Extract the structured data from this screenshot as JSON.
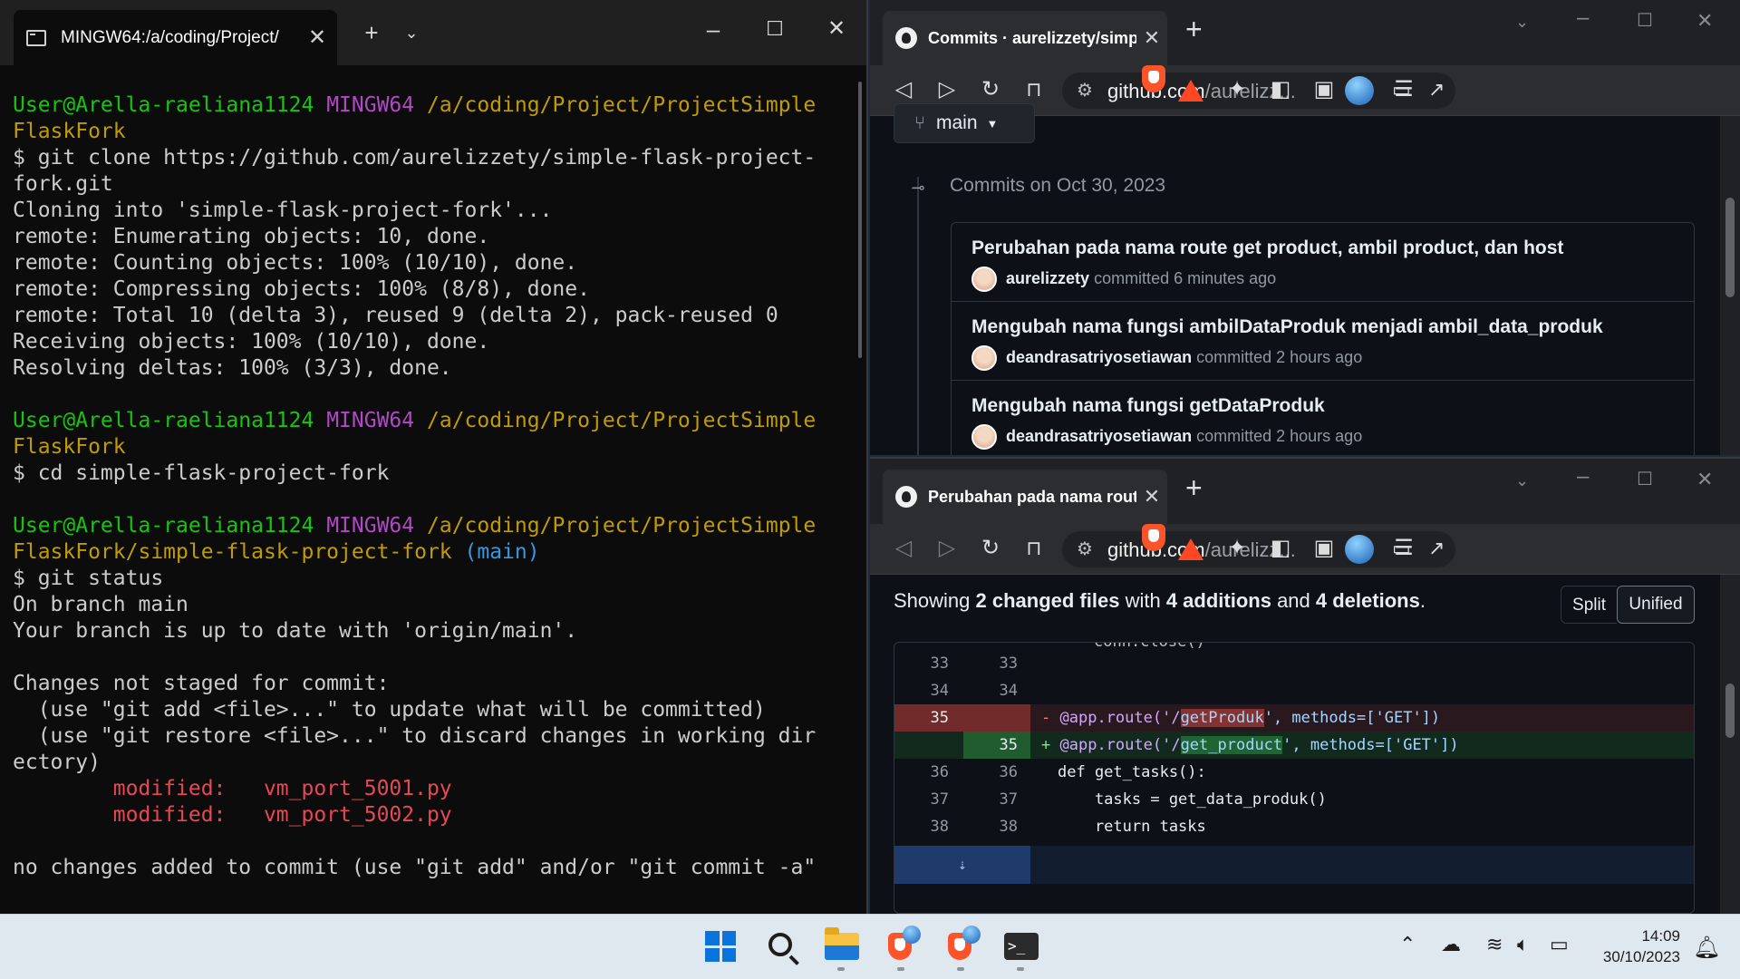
{
  "terminal": {
    "tab_title": "MINGW64:/a/coding/Project/",
    "lines": [
      [
        {
          "t": "User@Arella-raeliana1124 ",
          "c": "green"
        },
        {
          "t": "MINGW64 ",
          "c": "purple"
        },
        {
          "t": "/a/coding/Project/ProjectSimple",
          "c": "yellow"
        }
      ],
      [
        {
          "t": "FlaskFork",
          "c": "yellow"
        }
      ],
      [
        {
          "t": "$ git clone https://github.com/aurelizzety/simple-flask-project-",
          "c": "white"
        }
      ],
      [
        {
          "t": "fork.git",
          "c": "white"
        }
      ],
      [
        {
          "t": "Cloning into 'simple-flask-project-fork'...",
          "c": "white"
        }
      ],
      [
        {
          "t": "remote: Enumerating objects: 10, done.",
          "c": "white"
        }
      ],
      [
        {
          "t": "remote: Counting objects: 100% (10/10), done.",
          "c": "white"
        }
      ],
      [
        {
          "t": "remote: Compressing objects: 100% (8/8), done.",
          "c": "white"
        }
      ],
      [
        {
          "t": "remote: Total 10 (delta 3), reused 9 (delta 2), pack-reused 0",
          "c": "white"
        }
      ],
      [
        {
          "t": "Receiving objects: 100% (10/10), done.",
          "c": "white"
        }
      ],
      [
        {
          "t": "Resolving deltas: 100% (3/3), done.",
          "c": "white"
        }
      ],
      [
        {
          "t": "",
          "c": "white"
        }
      ],
      [
        {
          "t": "User@Arella-raeliana1124 ",
          "c": "green"
        },
        {
          "t": "MINGW64 ",
          "c": "purple"
        },
        {
          "t": "/a/coding/Project/ProjectSimple",
          "c": "yellow"
        }
      ],
      [
        {
          "t": "FlaskFork",
          "c": "yellow"
        }
      ],
      [
        {
          "t": "$ cd simple-flask-project-fork",
          "c": "white"
        }
      ],
      [
        {
          "t": "",
          "c": "white"
        }
      ],
      [
        {
          "t": "User@Arella-raeliana1124 ",
          "c": "green"
        },
        {
          "t": "MINGW64 ",
          "c": "purple"
        },
        {
          "t": "/a/coding/Project/ProjectSimple",
          "c": "yellow"
        }
      ],
      [
        {
          "t": "FlaskFork/simple-flask-project-fork ",
          "c": "yellow"
        },
        {
          "t": "(main)",
          "c": "cyan"
        }
      ],
      [
        {
          "t": "$ git status",
          "c": "white"
        }
      ],
      [
        {
          "t": "On branch main",
          "c": "white"
        }
      ],
      [
        {
          "t": "Your branch is up to date with 'origin/main'.",
          "c": "white"
        }
      ],
      [
        {
          "t": "",
          "c": "white"
        }
      ],
      [
        {
          "t": "Changes not staged for commit:",
          "c": "white"
        }
      ],
      [
        {
          "t": "  (use \"git add <file>...\" to update what will be committed)",
          "c": "white"
        }
      ],
      [
        {
          "t": "  (use \"git restore <file>...\" to discard changes in working dir",
          "c": "white"
        }
      ],
      [
        {
          "t": "ectory)",
          "c": "white"
        }
      ],
      [
        {
          "t": "        modified:   vm_port_5001.py",
          "c": "red"
        }
      ],
      [
        {
          "t": "        modified:   vm_port_5002.py",
          "c": "red"
        }
      ],
      [
        {
          "t": "",
          "c": "white"
        }
      ],
      [
        {
          "t": "no changes added to commit (use \"git add\" and/or \"git commit -a\"",
          "c": "white"
        }
      ]
    ]
  },
  "browser_top": {
    "tab_title": "Commits · aurelizzety/simple-fla",
    "url_host": "github.com",
    "url_rest": "/aurelizz...",
    "branch": "main",
    "commits_date": "Commits on Oct 30, 2023",
    "commits": [
      {
        "message": "Perubahan pada nama route get product, ambil product, dan host",
        "author": "aurelizzety",
        "time": "committed 6 minutes ago"
      },
      {
        "message": "Mengubah nama fungsi ambilDataProduk menjadi ambil_data_produk",
        "author": "deandrasatriyosetiawan",
        "time": "committed 2 hours ago"
      },
      {
        "message": "Mengubah nama fungsi getDataProduk",
        "author": "deandrasatriyosetiawan",
        "time": "committed 2 hours ago"
      }
    ]
  },
  "browser_bottom": {
    "tab_title": "Perubahan pada nama route get",
    "url_host": "github.com",
    "url_rest": "/aurelizz...",
    "summary": {
      "prefix": "Showing ",
      "files": "2 changed files",
      "mid1": " with ",
      "additions": "4 additions",
      "mid2": " and ",
      "deletions": "4 deletions",
      "suffix": "."
    },
    "split_label": "Split",
    "unified_label": "Unified",
    "diff_rows": [
      {
        "type": "ctx",
        "l": "33",
        "r": "33",
        "code": ""
      },
      {
        "type": "ctx",
        "l": "34",
        "r": "34",
        "code": ""
      },
      {
        "type": "del",
        "l": "35",
        "r": "",
        "sign": "-",
        "pre": "@app.route('/",
        "mark": "getProduk",
        "post": "', methods=['GET'])"
      },
      {
        "type": "add",
        "l": "",
        "r": "35",
        "sign": "+",
        "pre": "@app.route('/",
        "mark": "get_product",
        "post": "', methods=['GET'])"
      },
      {
        "type": "ctx",
        "l": "36",
        "r": "36",
        "code": "def get_tasks():"
      },
      {
        "type": "ctx",
        "l": "37",
        "r": "37",
        "code": "    tasks = get_data_produk()"
      },
      {
        "type": "ctx",
        "l": "38",
        "r": "38",
        "code": "    return tasks"
      }
    ],
    "partial_line": "conn.close()"
  },
  "taskbar": {
    "time": "14:09",
    "date": "30/10/2023"
  },
  "colors": {
    "terminal_bg": "#0c0c0c",
    "github_bg": "#0d1117",
    "taskbar_bg": "#dfe7ef"
  }
}
